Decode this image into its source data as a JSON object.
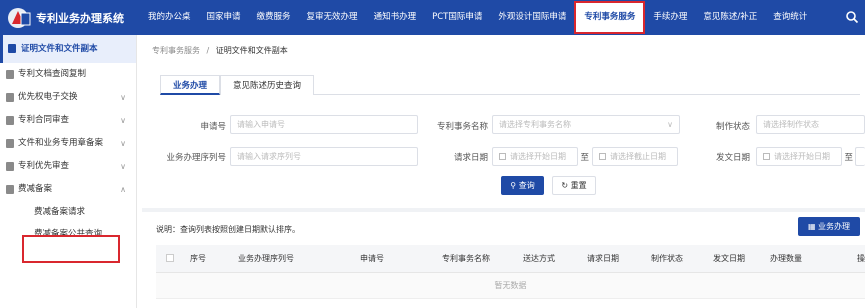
{
  "app": {
    "title": "专利业务办理系统"
  },
  "nav": {
    "items": [
      "我的办公桌",
      "国家申请",
      "缴费服务",
      "复审无效办理",
      "通知书办理",
      "PCT国际申请",
      "外观设计国际申请",
      "专利事务服务",
      "手续办理",
      "意见陈述/补正",
      "查询统计"
    ],
    "active": "专利事务服务"
  },
  "sidebar": {
    "header": "证明文件和文件副本",
    "items": [
      {
        "label": "专利文档查阅复制",
        "chevron": ""
      },
      {
        "label": "优先权电子交换",
        "chevron": "∨"
      },
      {
        "label": "专利合同审查",
        "chevron": "∨"
      },
      {
        "label": "文件和业务专用章备案",
        "chevron": "∨"
      },
      {
        "label": "专利优先审查",
        "chevron": "∨"
      },
      {
        "label": "费减备案",
        "chevron": "∧"
      }
    ],
    "subitems": [
      "费减备案请求",
      "费减备案公共查询"
    ]
  },
  "breadcrumb": {
    "parent": "专利事务服务",
    "separator": "/",
    "current": "证明文件和文件副本"
  },
  "tabs": [
    "业务办理",
    "意见陈述历史查询"
  ],
  "form": {
    "application_no": {
      "label": "申请号",
      "placeholder": "请输入申请号"
    },
    "matter_name": {
      "label": "专利事务名称",
      "placeholder": "请选择专利事务名称"
    },
    "status": {
      "label": "制作状态",
      "placeholder": "请选择制作状态"
    },
    "serial_no": {
      "label": "业务办理序列号",
      "placeholder": "请输入请求序列号"
    },
    "request_date": {
      "label": "请求日期",
      "start": "请选择开始日期",
      "to": "至",
      "end": "请选择截止日期"
    },
    "issue_date": {
      "label": "发文日期",
      "start": "请选择开始日期",
      "to": "至"
    }
  },
  "buttons": {
    "query": "查询",
    "reset": "重置",
    "business": "业务办理"
  },
  "note": "说明：查询列表按照创建日期默认排序。",
  "table": {
    "columns": [
      "序号",
      "业务办理序列号",
      "申请号",
      "专利事务名称",
      "送达方式",
      "请求日期",
      "制作状态",
      "发文日期",
      "办理数量",
      "操"
    ],
    "empty": "暂无数据"
  },
  "colors": {
    "primary": "#1f4aa6",
    "highlight": "#d9272e"
  }
}
